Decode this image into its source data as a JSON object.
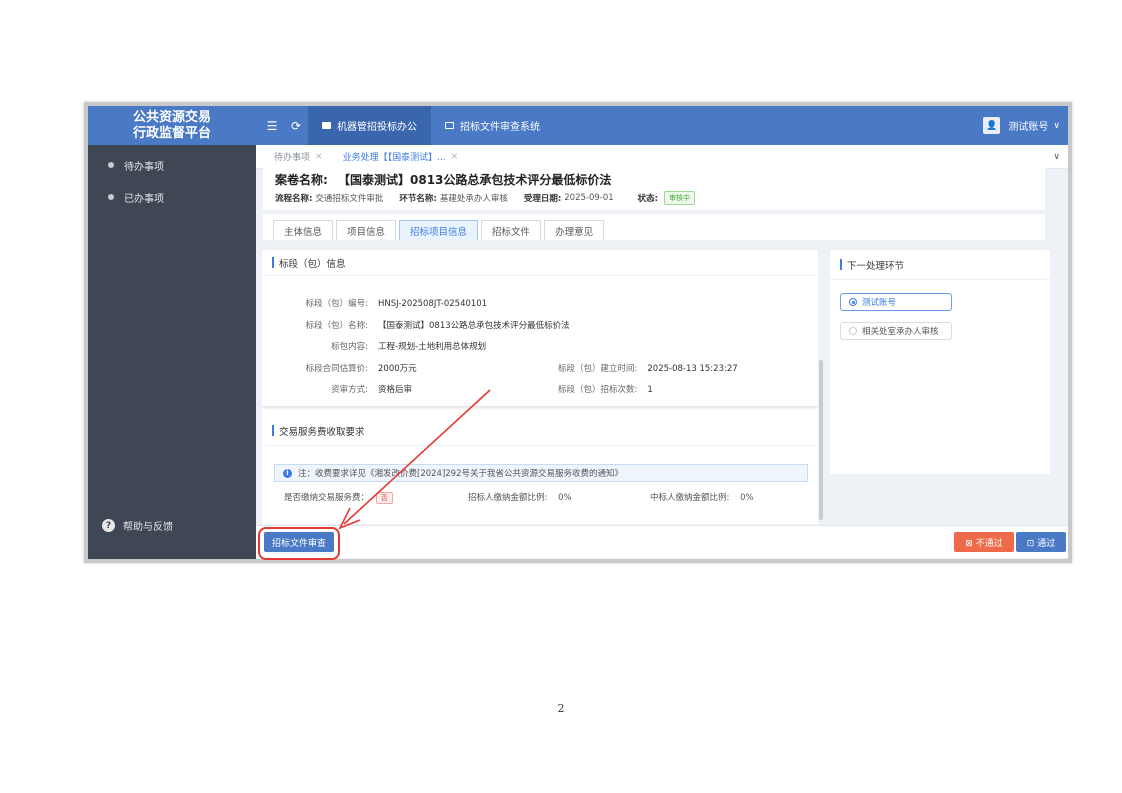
{
  "sidebar": {
    "brand_line1": "公共资源交易",
    "brand_line2": "行政监督平台",
    "items": [
      {
        "label": "待办事项"
      },
      {
        "label": "已办事项"
      }
    ],
    "help_label": "帮助与反馈"
  },
  "topbar": {
    "tabs": [
      {
        "label": "机器管招投标办公"
      },
      {
        "label": "招标文件审查系统"
      }
    ],
    "user_label": "测试账号"
  },
  "page_tabs": [
    {
      "label": "待办事项"
    },
    {
      "label": "业务处理【【国泰测试】..."
    }
  ],
  "case": {
    "title_label": "案卷名称:",
    "title_value": "【国泰测试】0813公路总承包技术评分最低标价法",
    "flow_label": "流程名称:",
    "flow_value": "交通招标文件审批",
    "node_label": "环节名称:",
    "node_value": "基建处承办人审核",
    "date_label": "受理日期:",
    "date_value": "2025-09-01",
    "status_label": "状态:",
    "status_value": "审核中"
  },
  "detail_tabs": [
    {
      "label": "主体信息"
    },
    {
      "label": "项目信息"
    },
    {
      "label": "招标项目信息"
    },
    {
      "label": "招标文件"
    },
    {
      "label": "办理意见"
    }
  ],
  "section_bid": {
    "title": "标段（包）信息",
    "fields": {
      "code_label": "标段（包）编号:",
      "code_value": "HNSJ-202508JT-02540101",
      "name_label": "标段（包）名称:",
      "name_value": "【国泰测试】0813公路总承包技术评分最低标价法",
      "content_label": "标包内容:",
      "content_value": "工程-规划-土地利用总体规划",
      "price_label": "标段合同估算价:",
      "price_value": "2000万元",
      "created_label": "标段（包）建立时间:",
      "created_value": "2025-08-13 15:23:27",
      "method_label": "资审方式:",
      "method_value": "资格后审",
      "count_label": "标段（包）招标次数:",
      "count_value": "1"
    }
  },
  "section_fee": {
    "title": "交易服务费收取要求",
    "notice": "注：收费要求详见《湘发改价费[2024]292号关于我省公共资源交易服务收费的通知》",
    "pay_label": "是否缴纳交易服务费：",
    "pay_value": "否",
    "tenderer_label": "招标人缴纳金额比例:",
    "tenderer_value": "0%",
    "winner_label": "中标人缴纳金额比例:",
    "winner_value": "0%"
  },
  "next_step": {
    "title": "下一处理环节",
    "options": [
      {
        "label": "测试账号",
        "checked": true
      },
      {
        "label": "相关处室承办人审核",
        "checked": false
      }
    ]
  },
  "actions": {
    "review_label": "招标文件审查",
    "reject_label": "不通过",
    "pass_label": "通过"
  },
  "page_number": "2",
  "colors": {
    "primary": "#4a79c5",
    "sidebar": "#3f4754",
    "reject": "#ef6a4b",
    "annotation": "#e53935"
  }
}
